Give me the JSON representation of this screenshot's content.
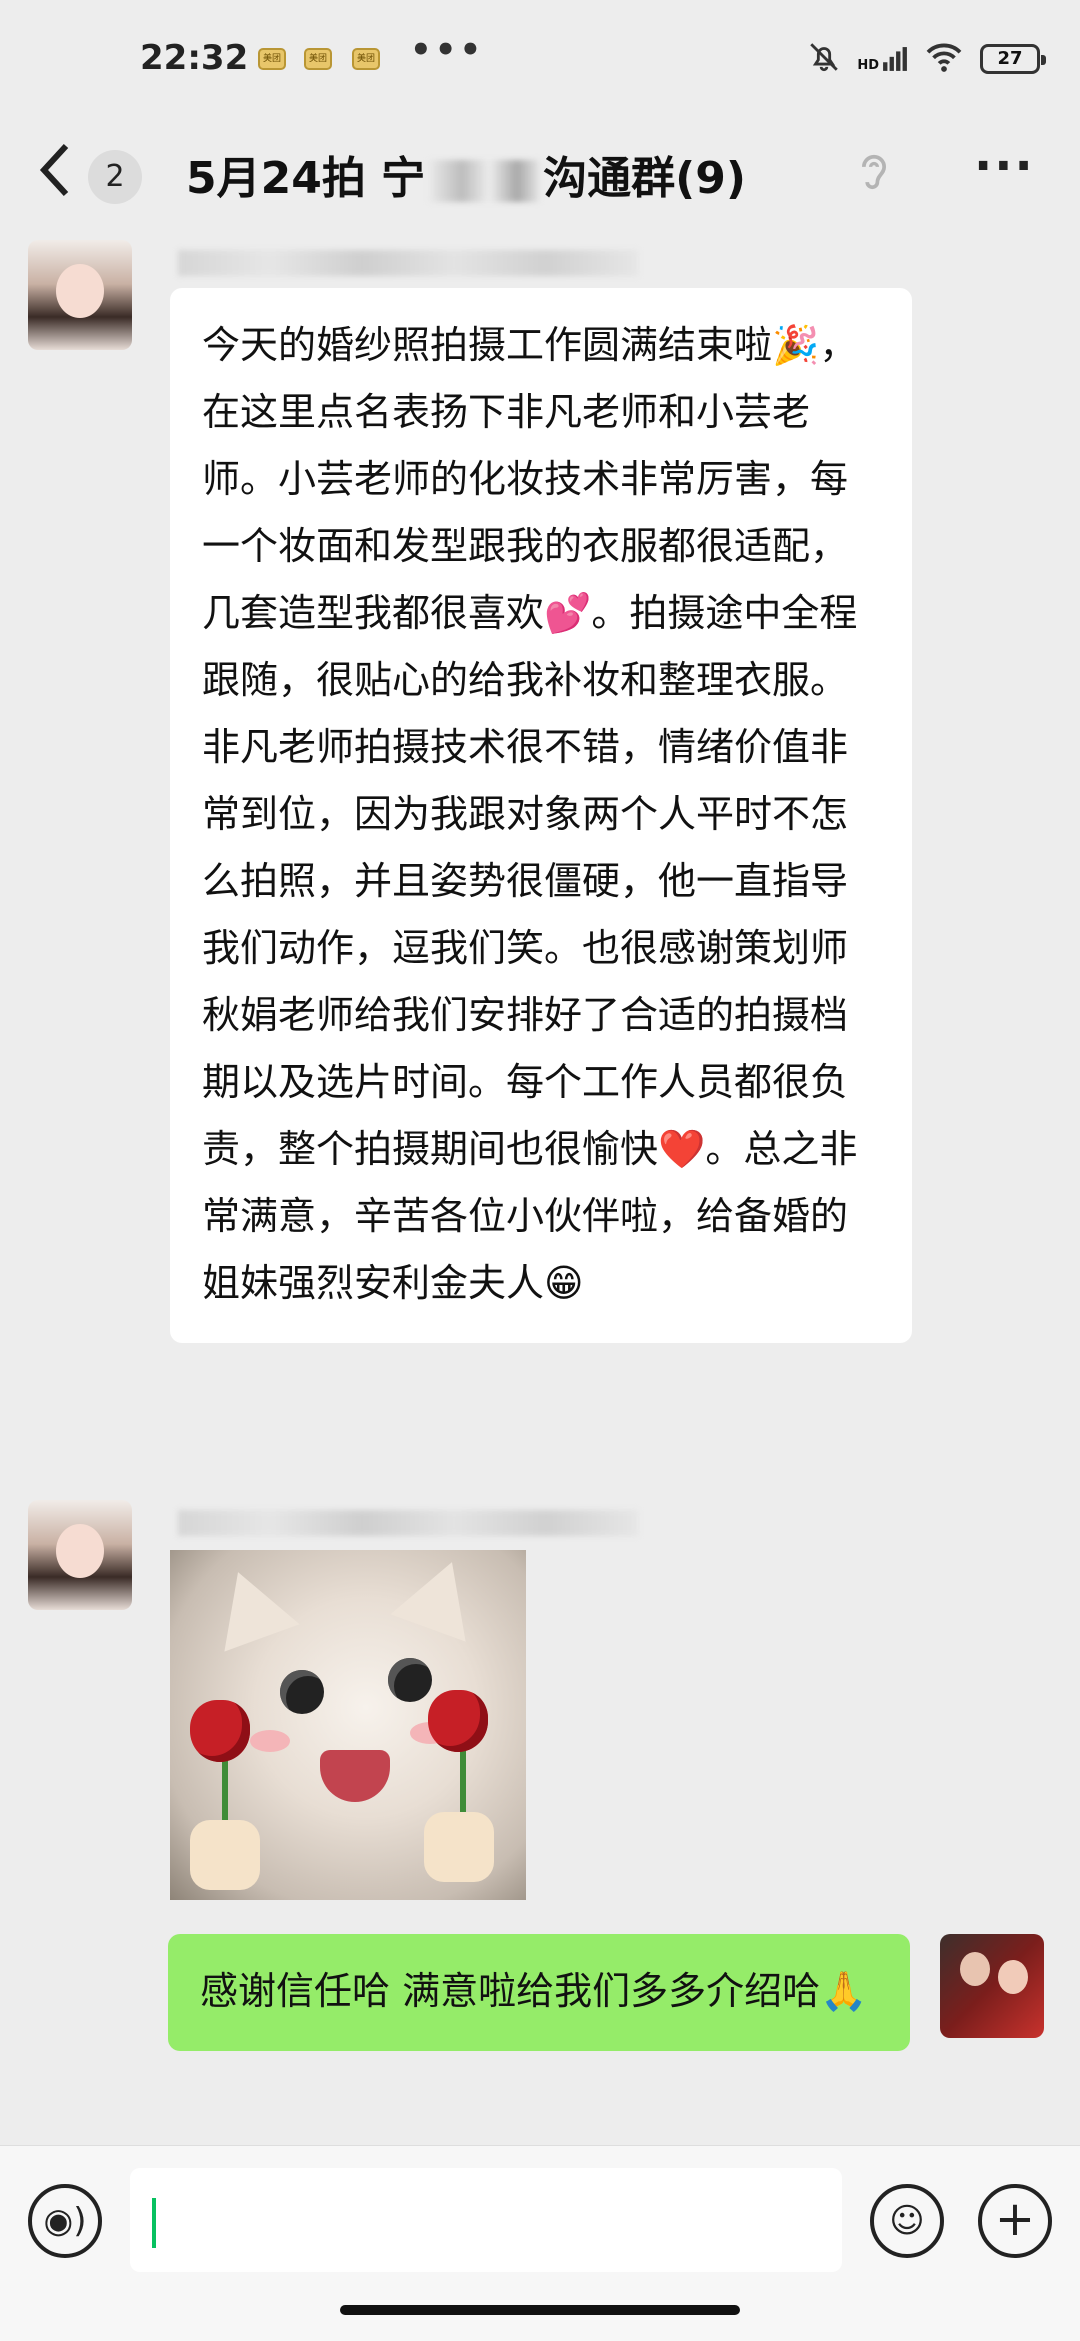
{
  "status_bar": {
    "time": "22:32",
    "notif_label": "美团",
    "more": "•••",
    "hd": "HD",
    "battery": "27",
    "icons": [
      "bell-muted-icon",
      "signal-icon",
      "wifi-icon",
      "battery-icon"
    ]
  },
  "nav": {
    "back_icon": "chevron-left-icon",
    "unread_count": "2",
    "title_prefix": "5月24拍 宁",
    "title_suffix": "沟通群(9)",
    "ear_icon": "ear-icon",
    "more": "···"
  },
  "messages": [
    {
      "side": "left",
      "type": "text",
      "text": "今天的婚纱照拍摄工作圆满结束啦🎉，在这里点名表扬下非凡老师和小芸老师。小芸老师的化妆技术非常厉害，每一个妆面和发型跟我的衣服都很适配，几套造型我都很喜欢💕。拍摄途中全程跟随，很贴心的给我补妆和整理衣服。非凡老师拍摄技术很不错，情绪价值非常到位，因为我跟对象两个人平时不怎么拍照，并且姿势很僵硬，他一直指导我们动作，逗我们笑。也很感谢策划师秋娟老师给我们安排好了合适的拍摄档期以及选片时间。每个工作人员都很负责，整个拍摄期间也很愉快❤️。总之非常满意，辛苦各位小伙伴啦，给备婚的姐妹强烈安利金夫人😁"
    },
    {
      "side": "left",
      "type": "sticker",
      "sticker": "cat-holding-roses-sticker"
    },
    {
      "side": "right",
      "type": "text",
      "text": "感谢信任哈  满意啦给我们多多介绍哈🙏"
    }
  ],
  "input_bar": {
    "voice_icon": "voice-icon",
    "voice_glyph": "◉)",
    "emoji_icon": "emoji-icon",
    "emoji_glyph": "☺",
    "plus_icon": "plus-icon",
    "plus_glyph": "+",
    "text_value": ""
  },
  "colors": {
    "background": "#ededed",
    "incoming_bubble": "#ffffff",
    "outgoing_bubble": "#95ec69",
    "cursor": "#07c160"
  }
}
